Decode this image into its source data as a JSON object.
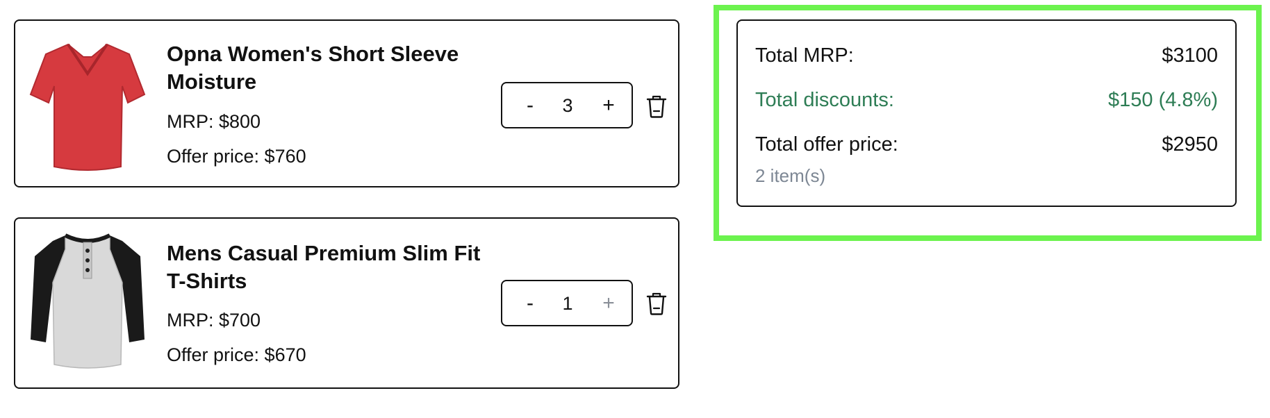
{
  "cart": {
    "items": [
      {
        "name": "Opna Women's Short Sleeve Moisture",
        "mrp": "MRP: $800",
        "offer_price": "Offer price: $760",
        "quantity": "3",
        "minus_label": "-",
        "plus_label": "+",
        "plus_enabled": true,
        "image": "red-v-neck-tshirt-image",
        "delete_icon": "trash-icon"
      },
      {
        "name": "Mens Casual Premium Slim Fit T-Shirts",
        "mrp": "MRP: $700",
        "offer_price": "Offer price: $670",
        "quantity": "1",
        "minus_label": "-",
        "plus_label": "+",
        "plus_enabled": false,
        "image": "henley-raglan-tshirt-image",
        "delete_icon": "trash-icon"
      }
    ]
  },
  "summary": {
    "total_mrp_label": "Total MRP:",
    "total_mrp_value": "$3100",
    "total_discounts_label": "Total discounts:",
    "total_discounts_value": "$150 (4.8%)",
    "total_offer_label": "Total offer price:",
    "total_offer_value": "$2950",
    "items_count": "2 item(s)"
  },
  "colors": {
    "discount_green": "#2e7d55",
    "muted_gray": "#7d8794",
    "highlight_green": "#6cf34e",
    "border": "#111111"
  }
}
